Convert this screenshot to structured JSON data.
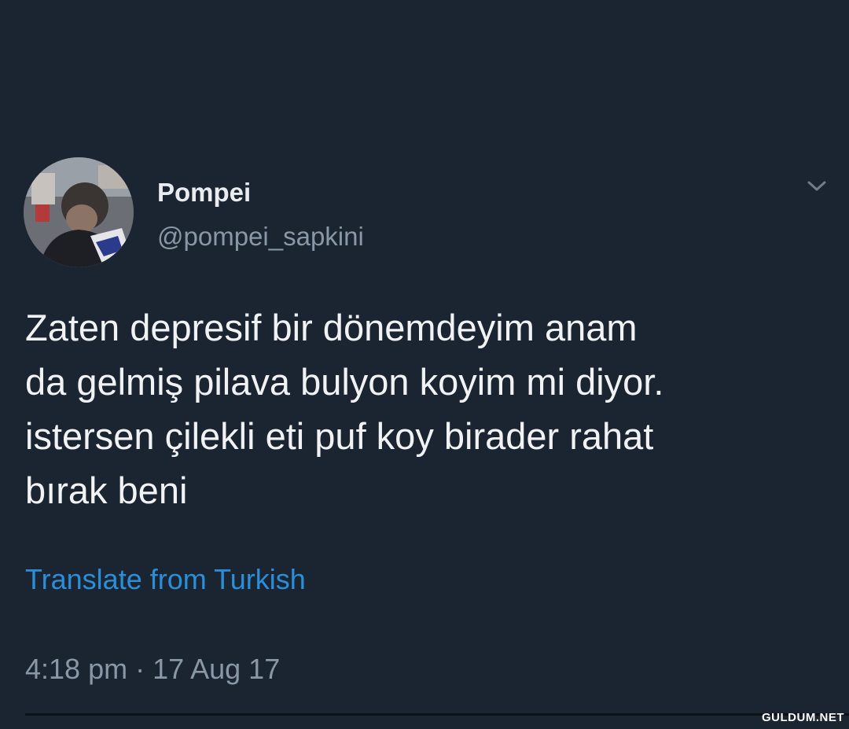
{
  "tweet": {
    "author": {
      "display_name": "Pompei",
      "handle": "@pompei_sapkini",
      "avatar_icon": "profile-photo"
    },
    "menu_icon": "chevron-down-icon",
    "text": "Zaten depresif bir dönemdeyim anam\nda gelmiş pilava bulyon koyim mi diyor.\nistersen çilekli eti puf koy birader rahat\nbırak beni",
    "translate_label": "Translate from Turkish",
    "timestamp": "4:18 pm · 17 Aug 17"
  },
  "watermark": "GULDUM.NET",
  "colors": {
    "background": "#1b2431",
    "text": "#f0f2f4",
    "muted": "#8a97a6",
    "link": "#2a8fd8"
  }
}
